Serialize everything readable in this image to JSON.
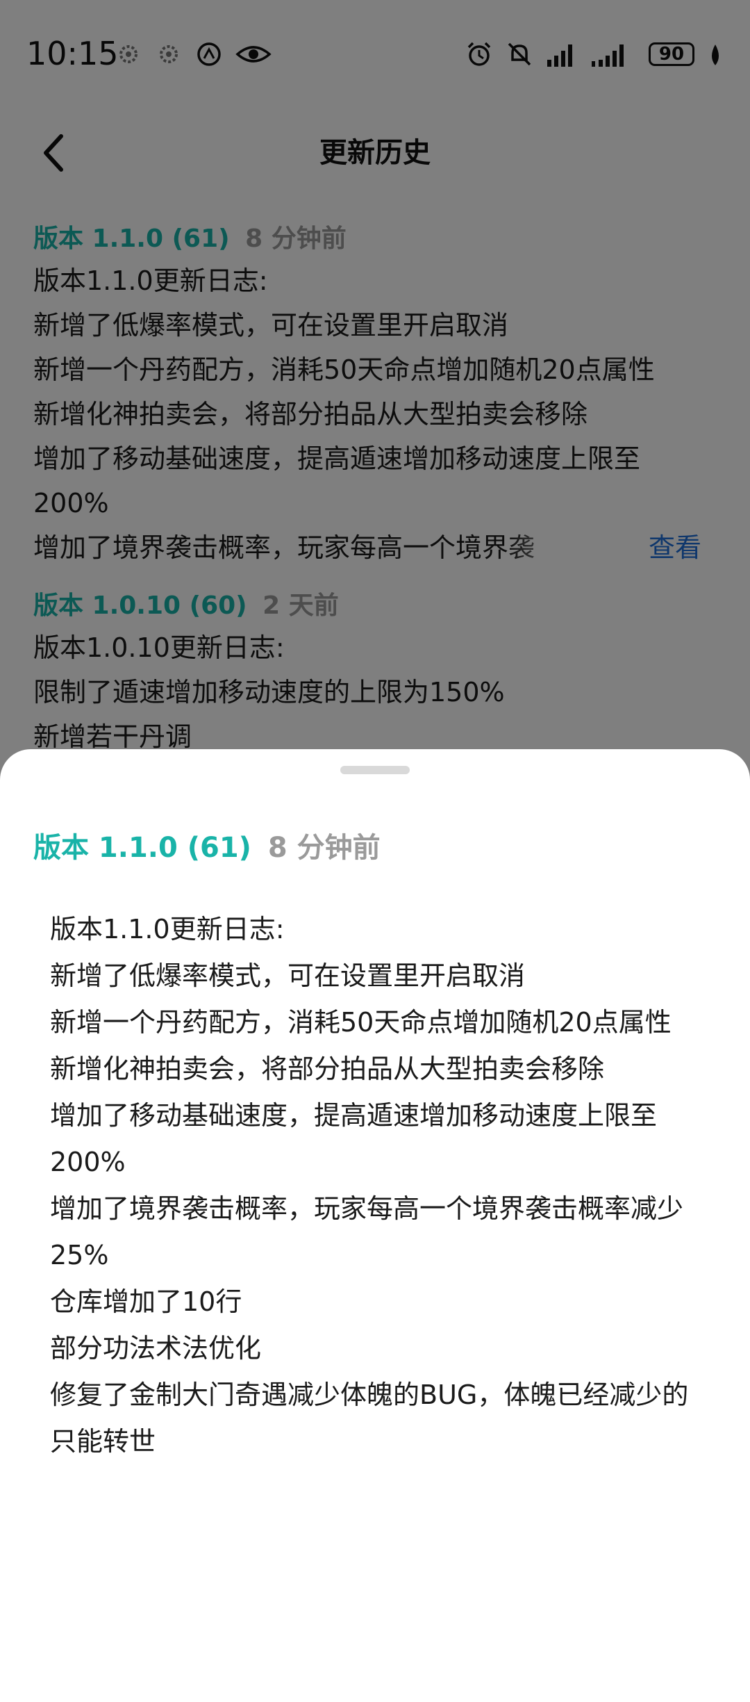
{
  "status_bar": {
    "time": "10:15",
    "battery": "90",
    "icons": [
      "gear-notification-icon",
      "gear-notification-icon",
      "data-saver-icon",
      "eye-icon",
      "alarm-icon",
      "mute-icon",
      "signal-icon",
      "signal-icon",
      "battery-icon",
      "leaf-icon"
    ]
  },
  "header": {
    "title": "更新历史",
    "back_icon": "chevron-left-icon"
  },
  "history": [
    {
      "version": "版本 1.1.0 (61)",
      "time": "8 分钟前",
      "lines": [
        "版本1.1.0更新日志:",
        "新增了低爆率模式，可在设置里开启取消",
        "新增一个丹药配方，消耗50天命点增加随机20点属性",
        "新增化神拍卖会，将部分拍品从大型拍卖会移除",
        "增加了移动基础速度，提高遁速增加移动速度上限至200%"
      ],
      "truncated_line": "增加了境界袭击概率，玩家每高一个境界袭",
      "view_label": "查看"
    },
    {
      "version": "版本 1.0.10 (60)",
      "time": "2 天前",
      "lines": [
        "版本1.0.10更新日志:",
        "限制了遁速增加移动速度的上限为150%",
        "新增若干丹调"
      ]
    }
  ],
  "sheet": {
    "version": "版本 1.1.0 (61)",
    "time": "8 分钟前",
    "lines": [
      "版本1.1.0更新日志:",
      "新增了低爆率模式，可在设置里开启取消",
      "新增一个丹药配方，消耗50天命点增加随机20点属性",
      "新增化神拍卖会，将部分拍品从大型拍卖会移除",
      "增加了移动基础速度，提高遁速增加移动速度上限至200%",
      "增加了境界袭击概率，玩家每高一个境界袭击概率减少25%",
      "仓库增加了10行",
      "部分功法术法优化",
      "修复了金制大门奇遇减少体魄的BUG，体魄已经减少的只能转世"
    ]
  },
  "colors": {
    "accent": "#19b3a8",
    "link": "#1e6fd9",
    "muted": "#9a9a9a",
    "scrim": "rgba(0,0,0,0.5)"
  }
}
